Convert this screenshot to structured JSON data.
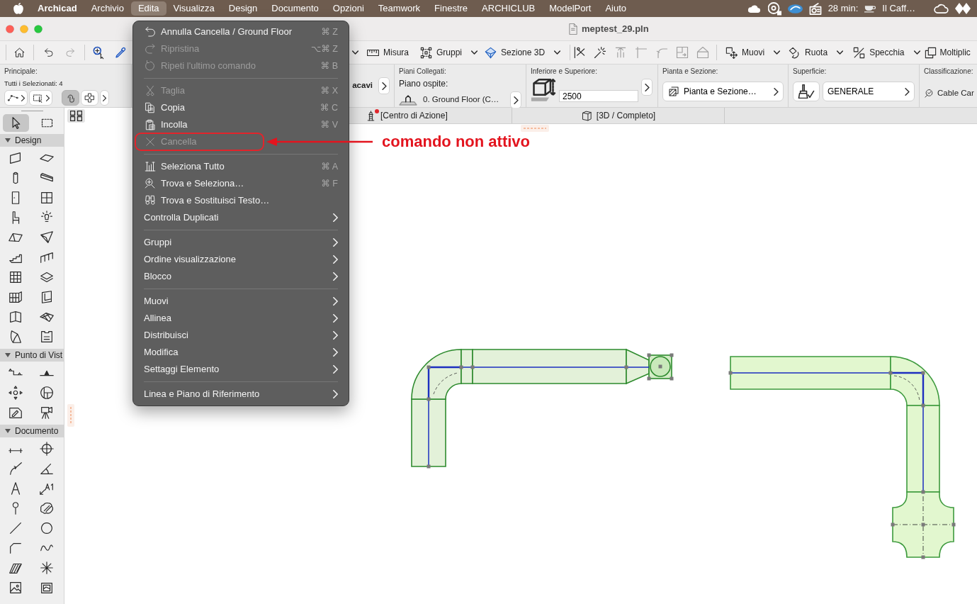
{
  "menu_bar": {
    "app_name": "Archicad",
    "menus": [
      {
        "label": "Archivio",
        "selected": false
      },
      {
        "label": "Edita",
        "selected": true
      },
      {
        "label": "Visualizza",
        "selected": false
      },
      {
        "label": "Design",
        "selected": false
      },
      {
        "label": "Documento",
        "selected": false
      },
      {
        "label": "Opzioni",
        "selected": false
      },
      {
        "label": "Teamwork",
        "selected": false
      },
      {
        "label": "Finestre",
        "selected": false
      },
      {
        "label": "ARCHICLUB",
        "selected": false
      },
      {
        "label": "ModelPort",
        "selected": false
      },
      {
        "label": "Aiuto",
        "selected": false
      }
    ],
    "timer": "28 min:",
    "now_playing": "Il Caff…"
  },
  "window": {
    "title": "meptest_29.pln"
  },
  "toolbar": {
    "quick_tools": [
      {
        "disabled": false
      },
      {
        "disabled": false
      },
      {
        "disabled": true
      },
      {
        "disabled": false
      },
      {
        "disabled": false
      }
    ],
    "view_buttons": [
      {
        "label": "Misura",
        "dropdown": false
      },
      {
        "label": "Gruppi",
        "dropdown": true
      },
      {
        "label": "Sezione 3D",
        "dropdown": true
      }
    ],
    "edit_tools": [
      {
        "disabled": false
      },
      {
        "disabled": false
      },
      {
        "disabled": true
      },
      {
        "disabled": true
      },
      {
        "disabled": true
      },
      {
        "disabled": true
      },
      {
        "disabled": true
      }
    ],
    "transform_buttons": [
      {
        "label": "Muovi",
        "dropdown": true
      },
      {
        "label": "Ruota",
        "dropdown": true
      },
      {
        "label": "Specchia",
        "dropdown": true
      },
      {
        "label": "Moltiplic",
        "dropdown": false
      }
    ]
  },
  "info_box": {
    "principale": {
      "heading": "Principale:",
      "selection": "Tutti i Selezionati: 4",
      "buttons": [
        {
          "pressed": false
        },
        {
          "pressed": false
        },
        {
          "pressed": true
        },
        {
          "pressed": false
        }
      ]
    },
    "partial_label": "acavi",
    "piani_collegati": {
      "heading": "Piani Collegati:",
      "label": "Piano ospite:",
      "value": "0. Ground Floor (C…"
    },
    "inferiore_superiore": {
      "heading": "Inferiore e Superiore:",
      "value": "2500"
    },
    "pianta_sezione": {
      "heading": "Pianta e Sezione:",
      "value": "Pianta e Sezione…"
    },
    "superficie": {
      "heading": "Superficie:",
      "value": "GENERALE"
    },
    "classificazione": {
      "heading": "Classificazione:",
      "value": "Cable Car"
    }
  },
  "view_tabs": [
    {
      "label": "[Centro di Azione]",
      "alert": true
    },
    {
      "label": "[3D / Completo]",
      "alert": false
    }
  ],
  "toolbox": {
    "pointer_tools": [
      {
        "selected": true
      },
      {
        "selected": false
      }
    ],
    "groups": [
      {
        "title": "Design",
        "expanded": true,
        "tools": [
          {
            "selected": false
          },
          {
            "selected": false
          },
          {
            "selected": false
          },
          {
            "selected": false
          },
          {
            "selected": false
          },
          {
            "selected": false
          },
          {
            "selected": false
          },
          {
            "selected": false
          },
          {
            "selected": false
          },
          {
            "selected": false
          },
          {
            "selected": false
          },
          {
            "selected": false
          },
          {
            "selected": false
          },
          {
            "selected": false
          },
          {
            "selected": false
          },
          {
            "selected": false
          },
          {
            "selected": false
          },
          {
            "selected": false
          },
          {
            "selected": false
          },
          {
            "selected": false
          }
        ]
      },
      {
        "title": "Punto di Vist",
        "expanded": true,
        "tools": [
          {
            "selected": false
          },
          {
            "selected": false
          },
          {
            "selected": false
          },
          {
            "selected": false
          },
          {
            "selected": false
          },
          {
            "selected": false
          }
        ]
      },
      {
        "title": "Documento",
        "expanded": true,
        "tools": [
          {
            "selected": false
          },
          {
            "selected": false
          },
          {
            "selected": false
          },
          {
            "selected": false
          },
          {
            "selected": false
          },
          {
            "selected": false
          },
          {
            "selected": false
          },
          {
            "selected": false
          },
          {
            "selected": false
          },
          {
            "selected": false
          },
          {
            "selected": false
          },
          {
            "selected": false
          },
          {
            "selected": false
          },
          {
            "selected": false
          },
          {
            "selected": false
          },
          {
            "selected": false
          }
        ]
      }
    ]
  },
  "edit_menu": {
    "items": [
      {
        "kind": "command",
        "label": "Annulla Cancella / Ground Floor",
        "shortcut": "⌘ Z",
        "disabled": false,
        "highlighted": false
      },
      {
        "kind": "command",
        "label": "Ripristina",
        "shortcut": "⌥⌘ Z",
        "disabled": true,
        "highlighted": false
      },
      {
        "kind": "command",
        "label": "Ripeti l'ultimo comando",
        "shortcut": "⌘ B",
        "disabled": true,
        "highlighted": false
      },
      {
        "kind": "separator"
      },
      {
        "kind": "command",
        "label": "Taglia",
        "shortcut": "⌘ X",
        "disabled": true,
        "highlighted": false
      },
      {
        "kind": "command",
        "label": "Copia",
        "shortcut": "⌘ C",
        "disabled": false,
        "highlighted": false
      },
      {
        "kind": "command",
        "label": "Incolla",
        "shortcut": "⌘ V",
        "disabled": false,
        "highlighted": false
      },
      {
        "kind": "command",
        "label": "Cancella",
        "disabled": true,
        "highlighted": true
      },
      {
        "kind": "separator"
      },
      {
        "kind": "command",
        "label": "Seleziona Tutto",
        "shortcut": "⌘ A",
        "disabled": false,
        "highlighted": false
      },
      {
        "kind": "command",
        "label": "Trova e Seleziona…",
        "shortcut": "⌘ F",
        "disabled": false,
        "highlighted": false
      },
      {
        "kind": "command",
        "label": "Trova e Sostituisci Testo…",
        "disabled": false,
        "highlighted": false
      },
      {
        "kind": "submenu",
        "label": "Controlla Duplicati",
        "disabled": false,
        "highlighted": false
      },
      {
        "kind": "separator"
      },
      {
        "kind": "submenu",
        "label": "Gruppi",
        "disabled": false,
        "highlighted": false
      },
      {
        "kind": "submenu",
        "label": "Ordine visualizzazione",
        "disabled": false,
        "highlighted": false
      },
      {
        "kind": "submenu",
        "label": "Blocco",
        "disabled": false,
        "highlighted": false
      },
      {
        "kind": "separator"
      },
      {
        "kind": "submenu",
        "label": "Muovi",
        "disabled": false,
        "highlighted": false
      },
      {
        "kind": "submenu",
        "label": "Allinea",
        "disabled": false,
        "highlighted": false
      },
      {
        "kind": "submenu",
        "label": "Distribuisci",
        "disabled": false,
        "highlighted": false
      },
      {
        "kind": "submenu",
        "label": "Modifica",
        "disabled": false,
        "highlighted": false
      },
      {
        "kind": "submenu",
        "label": "Settaggi Elemento",
        "disabled": false,
        "highlighted": false
      },
      {
        "kind": "separator"
      },
      {
        "kind": "submenu",
        "label": "Linea e Piano di Riferimento",
        "disabled": false,
        "highlighted": false
      }
    ]
  },
  "annotation": {
    "text": "comando non attivo"
  }
}
